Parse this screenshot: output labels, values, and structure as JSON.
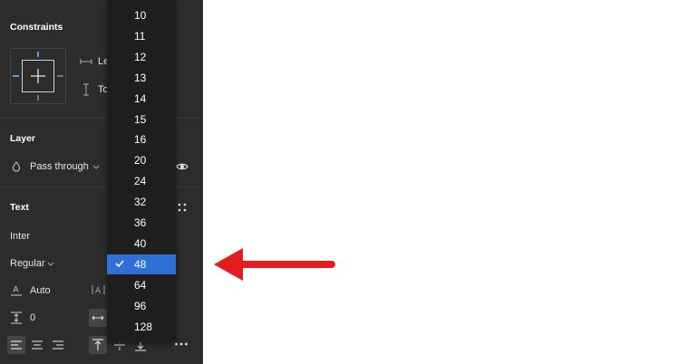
{
  "panel": {
    "constraints": {
      "title": "Constraints",
      "horizontal_label": "Le",
      "vertical_label": "To"
    },
    "layer": {
      "title": "Layer",
      "blend_mode": "Pass through"
    },
    "text": {
      "title": "Text",
      "font_family": "Inter",
      "font_style": "Regular",
      "line_height": "Auto",
      "paragraph_spacing": "0"
    }
  },
  "font_size_menu": {
    "items": [
      "10",
      "11",
      "12",
      "13",
      "14",
      "15",
      "16",
      "20",
      "24",
      "32",
      "36",
      "40",
      "48",
      "64",
      "96",
      "128"
    ],
    "selected": "48"
  },
  "colors": {
    "panel_bg": "#2c2c2c",
    "menu_bg": "#1e1e1e",
    "selection": "#2f6fd6",
    "arrow": "#e31d1d",
    "constraint_accent": "#4f9fe6"
  }
}
